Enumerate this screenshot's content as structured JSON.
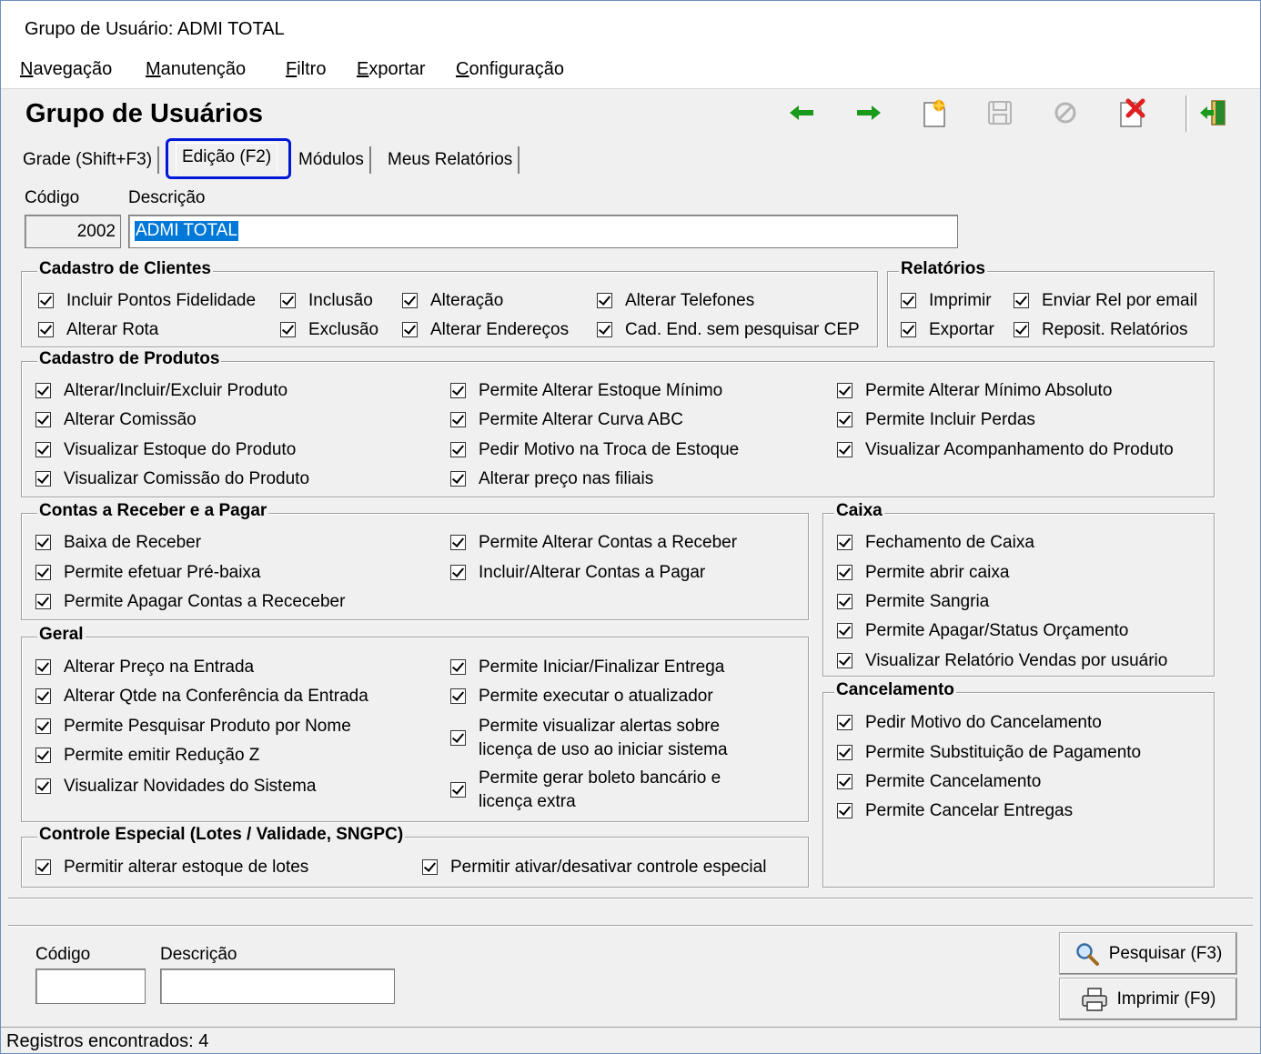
{
  "window": {
    "title": "Grupo de Usuário: ADMI TOTAL"
  },
  "menu": [
    "Navegação",
    "Manutenção",
    "Filtro",
    "Exportar",
    "Configuração"
  ],
  "header": {
    "title": "Grupo de Usuários"
  },
  "toolbar": {
    "icons": [
      "arrow-left-icon",
      "arrow-right-icon",
      "new-record-icon",
      "save-icon",
      "cancel-icon",
      "delete-icon",
      "exit-icon"
    ],
    "colors": {
      "arrows": "#1a9a1a",
      "new": "#f0a000",
      "delete": "#e02020",
      "exit": "#2a8a2a",
      "disabled": "#b4b4b4"
    }
  },
  "tabs": [
    {
      "label": "Grade (Shift+F3)"
    },
    {
      "label": "Edição (F2)",
      "active": true
    },
    {
      "label": "Módulos"
    },
    {
      "label": "Meus Relatórios"
    }
  ],
  "form": {
    "codigo_label": "Código",
    "descricao_label": "Descrição",
    "codigo_value": "2002",
    "descricao_value": "ADMI TOTAL"
  },
  "groups": {
    "cadastro_clientes": {
      "title": "Cadastro de Clientes",
      "items": [
        "Incluir Pontos Fidelidade",
        "Inclusão",
        "Alteração",
        "Alterar Telefones",
        "Alterar Rota",
        "Exclusão",
        "Alterar Endereços",
        "Cad. End. sem pesquisar CEP"
      ]
    },
    "relatorios": {
      "title": "Relatórios",
      "items": [
        "Imprimir",
        "Enviar Rel por email",
        "Exportar",
        "Reposit. Relatórios"
      ]
    },
    "cadastro_produtos": {
      "title": "Cadastro de Produtos",
      "items": [
        "Alterar/Incluir/Excluir Produto",
        "Alterar Comissão",
        "Visualizar Estoque do Produto",
        "Visualizar Comissão do Produto",
        "Permite Alterar Estoque Mínimo",
        "Permite Alterar Curva ABC",
        "Pedir Motivo na Troca de Estoque",
        "Alterar preço nas filiais",
        "Permite Alterar Mínimo Absoluto",
        "Permite Incluir Perdas",
        "Visualizar Acompanhamento do Produto"
      ]
    },
    "contas": {
      "title": "Contas a Receber e a Pagar",
      "items": [
        "Baixa de Receber",
        "Permite efetuar Pré-baixa",
        "Permite Apagar Contas a Receceber",
        "Permite Alterar Contas a Receber",
        "Incluir/Alterar Contas a Pagar"
      ]
    },
    "caixa": {
      "title": "Caixa",
      "items": [
        "Fechamento de Caixa",
        "Permite abrir caixa",
        "Permite Sangria",
        "Permite Apagar/Status Orçamento",
        "Visualizar Relatório Vendas por usuário"
      ]
    },
    "geral": {
      "title": "Geral",
      "items": [
        "Alterar Preço na Entrada",
        "Alterar Qtde na Conferência da Entrada",
        "Permite Pesquisar Produto por Nome",
        "Permite emitir Redução Z",
        "Visualizar Novidades do Sistema",
        "Permite Iniciar/Finalizar Entrega",
        "Permite executar o atualizador",
        "Permite visualizar alertas sobre licença de uso ao iniciar sistema",
        "Permite gerar boleto bancário e licença extra"
      ]
    },
    "cancelamento": {
      "title": "Cancelamento",
      "items": [
        "Pedir Motivo do Cancelamento",
        "Permite Substituição de Pagamento",
        "Permite Cancelamento",
        "Permite Cancelar Entregas"
      ]
    },
    "controle_especial": {
      "title": "Controle Especial (Lotes / Validade, SNGPC)",
      "items": [
        "Permitir alterar estoque de lotes",
        "Permitir ativar/desativar controle especial"
      ]
    }
  },
  "search": {
    "codigo_label": "Código",
    "descricao_label": "Descrição",
    "pesquisar_label": "Pesquisar (F3)",
    "imprimir_label": "Imprimir (F9)"
  },
  "status": {
    "text": "Registros encontrados: 4"
  }
}
